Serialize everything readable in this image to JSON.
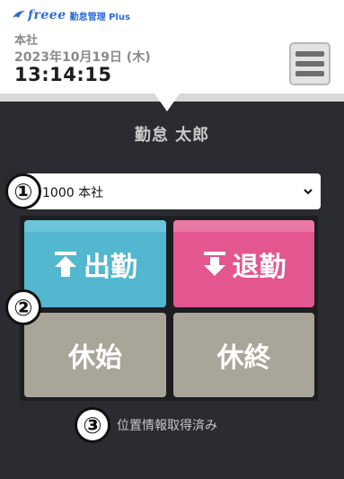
{
  "app": {
    "brand": "freee",
    "product": "勤怠管理 Plus"
  },
  "header": {
    "office": "本社",
    "date": "2023年10月19日 (木)",
    "time": "13:14:15"
  },
  "user": {
    "name": "勤怠 太郎"
  },
  "office_select": {
    "selected": "1000 本社"
  },
  "buttons": {
    "clock_in": "出勤",
    "clock_out": "退勤",
    "break_start": "休始",
    "break_end": "休終"
  },
  "badges": [
    "①",
    "②",
    "③"
  ],
  "location_status": "位置情報取得済み",
  "colors": {
    "clock_in": "#52b7cf",
    "clock_out": "#e3568f",
    "break": "#a9a598",
    "background": "#2b2c31"
  }
}
